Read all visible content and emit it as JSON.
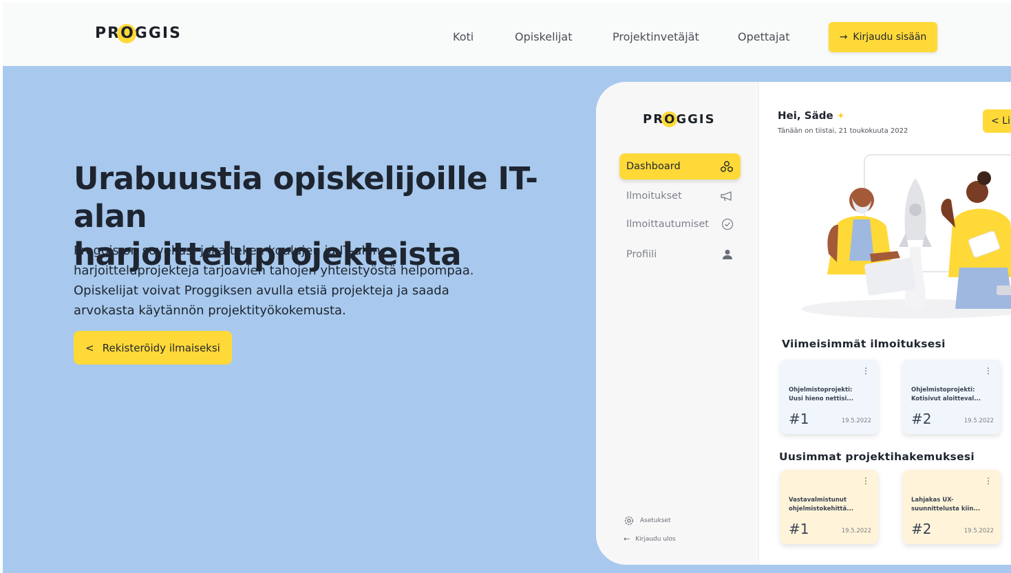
{
  "brand": {
    "logo_pre": "PR",
    "logo_o": "O",
    "logo_post": "GGIS",
    "accent": "#ffd938",
    "hero_bg": "#a8c9ed"
  },
  "nav": {
    "links": [
      "Koti",
      "Opiskelijat",
      "Projektinvetäjät",
      "Opettajat"
    ],
    "login_label": "Kirjaudu sisään",
    "login_icon": "arrow-right-icon"
  },
  "hero": {
    "title_line1": "Urabuustia opiskelijoille IT-alan",
    "title_line2": "harjoitteluprojekteista",
    "desc_lines": [
      "Proggis on sovellus, joka tekee koulujen ja IT-alan",
      "harjoitteluprojekteja tarjoavien tahojen yhteistyöstä helpompaa.",
      "Opiskelijat voivat Proggiksen avulla etsiä projekteja ja saada",
      "arvokasta käytännön projektityökokemusta."
    ],
    "register_label": "Rekisteröidy ilmaiseksi"
  },
  "mock": {
    "sidebar": [
      {
        "label": "Dashboard",
        "icon": "network-icon",
        "active": true
      },
      {
        "label": "Ilmoitukset",
        "icon": "megaphone-icon",
        "active": false
      },
      {
        "label": "Ilmoittautumiset",
        "icon": "check-circle-icon",
        "active": false
      },
      {
        "label": "Profiili",
        "icon": "user-icon",
        "active": false
      }
    ],
    "footer": [
      {
        "label": "Asetukset",
        "icon": "gear-icon"
      },
      {
        "label": "Kirjaudu ulos",
        "icon": "arrow-left-icon"
      }
    ],
    "greeting": "Hei, Säde",
    "date": "Tänään on tiistai, 21 toukokuuta 2022",
    "back_label": "< Li",
    "section1": "Viimeisimmät ilmoituksesi",
    "section2": "Uusimmat projektihakemuksesi",
    "cards1": [
      {
        "line1": "Ohjelmistoprojekti:",
        "line2": "Uusi hieno nettisi...",
        "num": "#1",
        "date": "19.5.2022"
      },
      {
        "line1": "Ohjelmistoprojekti:",
        "line2": "Kotisivut aloitteval...",
        "num": "#2",
        "date": "19.5.2022"
      }
    ],
    "cards2": [
      {
        "line1": "Vastavalmistunut",
        "line2": "ohjelmistokehittä...",
        "num": "#1",
        "date": "19.5.2022"
      },
      {
        "line1": "Lahjakas UX-",
        "line2": "suunnittelusta kiin...",
        "num": "#2",
        "date": "19.5.2022"
      }
    ]
  }
}
